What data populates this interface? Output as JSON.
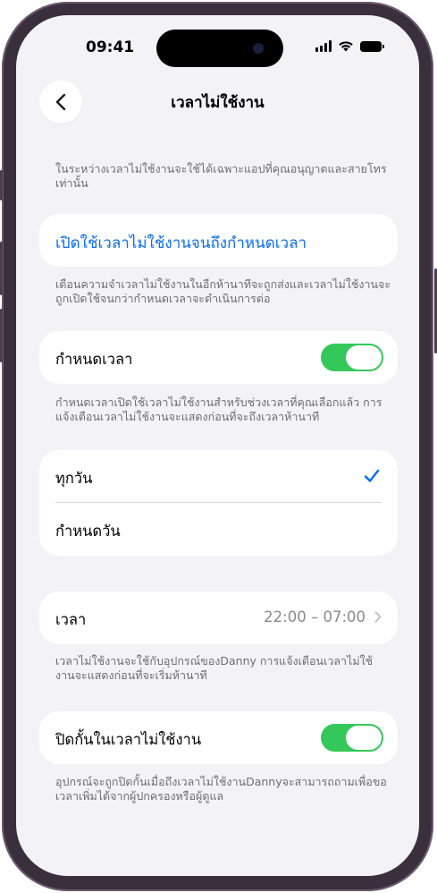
{
  "status_bar": {
    "time": "09:41"
  },
  "nav": {
    "title": "เวลาไม่ใช้งาน",
    "back_icon": "chevron-left-icon"
  },
  "intro_note": "ในระหว่างเวลาไม่ใช้งานจะใช้ได้เฉพาะแอปที่คุณอนุญาตและสายโทรเท่านั้น",
  "enable_until_schedule": {
    "label": "เปิดใช้เวลาไม่ใช้งานจนถึงกำหนดเวลา",
    "note": "เตือนความจำเวลาไม่ใช้งานในอีกห้านาทีจะถูกส่งและเวลาไม่ใช้งานจะถูกเปิดใช้จนกว่ากำหนดเวลาจะดำเนินการต่อ"
  },
  "scheduled": {
    "label": "กำหนดเวลา",
    "on": true,
    "note": "กำหนดเวลาเปิดใช้เวลาไม่ใช้งานสำหรับช่วงเวลาที่คุณเลือกแล้ว การแจ้งเตือนเวลาไม่ใช้งานจะแสดงก่อนที่จะถึงเวลาห้านาที"
  },
  "days": {
    "every_day": "ทุกวัน",
    "every_day_selected": true,
    "customize": "กำหนดวัน"
  },
  "time_row": {
    "label": "เวลา",
    "value": "22:00 – 07:00",
    "note": "เวลาไม่ใช้งานจะใช้กับอุปกรณ์ของDanny การแจ้งเตือนเวลาไม่ใช้งานจะแสดงก่อนที่จะเริ่มห้านาที"
  },
  "block_at_downtime": {
    "label": "ปิดกั้นในเวลาไม่ใช้งาน",
    "on": true,
    "note": "อุปกรณ์จะถูกปิดกั้นเมื่อถึงเวลาไม่ใช้งานDannyจะสามารถถามเพื่อขอเวลาเพิ่มได้จากผู้ปกครองหรือผู้ดูแล"
  },
  "colors": {
    "accent": "#0a6cf0",
    "toggle_on": "#34c759",
    "background": "#f2f2f7"
  }
}
